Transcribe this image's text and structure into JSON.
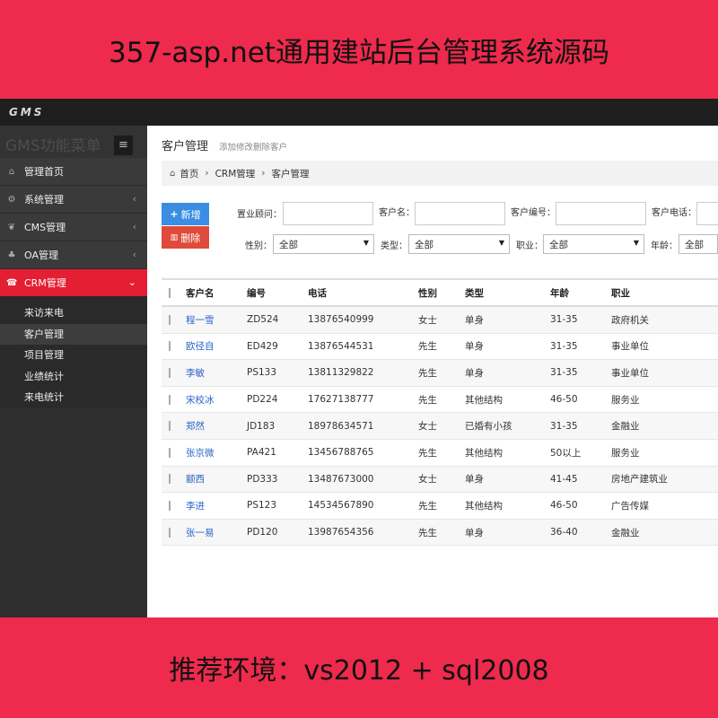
{
  "banner": {
    "top_text": "357-asp.net通用建站后台管理系统源码",
    "bottom_text": "推荐环境：vs2012 + sql2008"
  },
  "app": {
    "logo": {
      "prefix": "GMS",
      "suffix": ""
    },
    "sidebar": {
      "title": "GMS功能菜单",
      "items": [
        {
          "label": "管理首页",
          "icon": "home-icon"
        },
        {
          "label": "系统管理",
          "icon": "gear-icon"
        },
        {
          "label": "CMS管理",
          "icon": "leaf-icon"
        },
        {
          "label": "OA管理",
          "icon": "sitemap-icon"
        },
        {
          "label": "CRM管理",
          "icon": "phone-icon"
        }
      ],
      "submenu": [
        "来访来电",
        "客户管理",
        "项目管理",
        "业绩统计",
        "来电统计"
      ]
    },
    "page": {
      "title": "客户管理",
      "subtitle": "添加修改删除客户"
    },
    "breadcrumb": [
      "首页",
      "CRM管理",
      "客户管理"
    ],
    "buttons": {
      "add": "新增",
      "delete": "删除"
    },
    "filters": {
      "consultant": "置业顾问：",
      "customer_name": "客户名：",
      "customer_code": "客户编号：",
      "customer_phone": "客户电话：",
      "gender": "性别：",
      "type": "类型：",
      "job": "职业：",
      "age": "年龄：",
      "gender_value": "全部",
      "type_value": "全部",
      "job_value": "全部",
      "age_value": "全部"
    },
    "table": {
      "headers": [
        "客户名",
        "编号",
        "电话",
        "性别",
        "类型",
        "年龄",
        "职业"
      ],
      "rows": [
        [
          "程一雪",
          "ZD524",
          "13876540999",
          "女士",
          "单身",
          "31-35",
          "政府机关"
        ],
        [
          "欧径自",
          "ED429",
          "13876544531",
          "先生",
          "单身",
          "31-35",
          "事业单位"
        ],
        [
          "李敏",
          "PS133",
          "13811329822",
          "先生",
          "单身",
          "31-35",
          "事业单位"
        ],
        [
          "宋校冰",
          "PD224",
          "17627138777",
          "先生",
          "其他结构",
          "46-50",
          "服务业"
        ],
        [
          "郑然",
          "JD183",
          "18978634571",
          "女士",
          "已婚有小孩",
          "31-35",
          "金融业"
        ],
        [
          "张京微",
          "PA421",
          "13456788765",
          "先生",
          "其他结构",
          "50以上",
          "服务业"
        ],
        [
          "颛西",
          "PD333",
          "13487673000",
          "女士",
          "单身",
          "41-45",
          "房地产建筑业"
        ],
        [
          "李进",
          "PS123",
          "14534567890",
          "先生",
          "其他结构",
          "46-50",
          "广告传媒"
        ],
        [
          "张一易",
          "PD120",
          "13987654356",
          "先生",
          "单身",
          "36-40",
          "金融业"
        ]
      ]
    }
  }
}
